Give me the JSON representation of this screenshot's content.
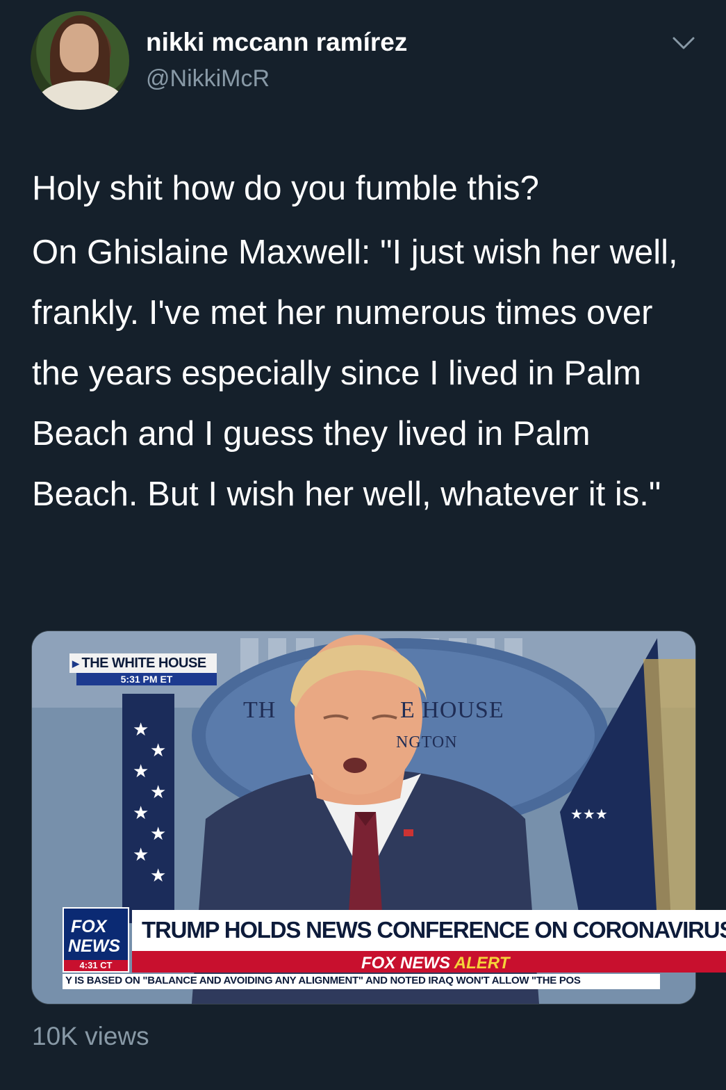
{
  "author": {
    "display_name": "nikki mccann ramírez",
    "handle": "@NikkiMcR"
  },
  "tweet": {
    "line1": "Holy shit how do you fumble this?",
    "body": "On Ghislaine Maxwell: \"I just wish her well, frankly. I've met her numerous times over the years especially since I lived in Palm Beach and I guess they lived in Palm Beach. But I wish her well, whatever it is.\""
  },
  "video_overlay": {
    "location_label": "THE WHITE HOUSE",
    "location_time": "5:31 PM ET",
    "seal_left": "TH",
    "seal_right": "E HOUSE",
    "seal_lower": "NGTON",
    "network_line1": "FOX",
    "network_line2": "NEWS",
    "network_time": "4:31 CT",
    "headline": "TRUMP HOLDS NEWS CONFERENCE ON CORONAVIRUS",
    "alert_prefix": "FOX NEWS",
    "alert_word": "ALERT",
    "ticker": "Y IS BASED ON \"BALANCE AND AVOIDING ANY ALIGNMENT\" AND NOTED IRAQ WON'T ALLOW \"THE POS"
  },
  "views": "10K views",
  "icons": {
    "more": "chevron-down-icon"
  },
  "colors": {
    "background": "#15202b",
    "secondary_text": "#8899a6",
    "fox_red": "#c8102e",
    "fox_blue": "#0b2a73"
  }
}
